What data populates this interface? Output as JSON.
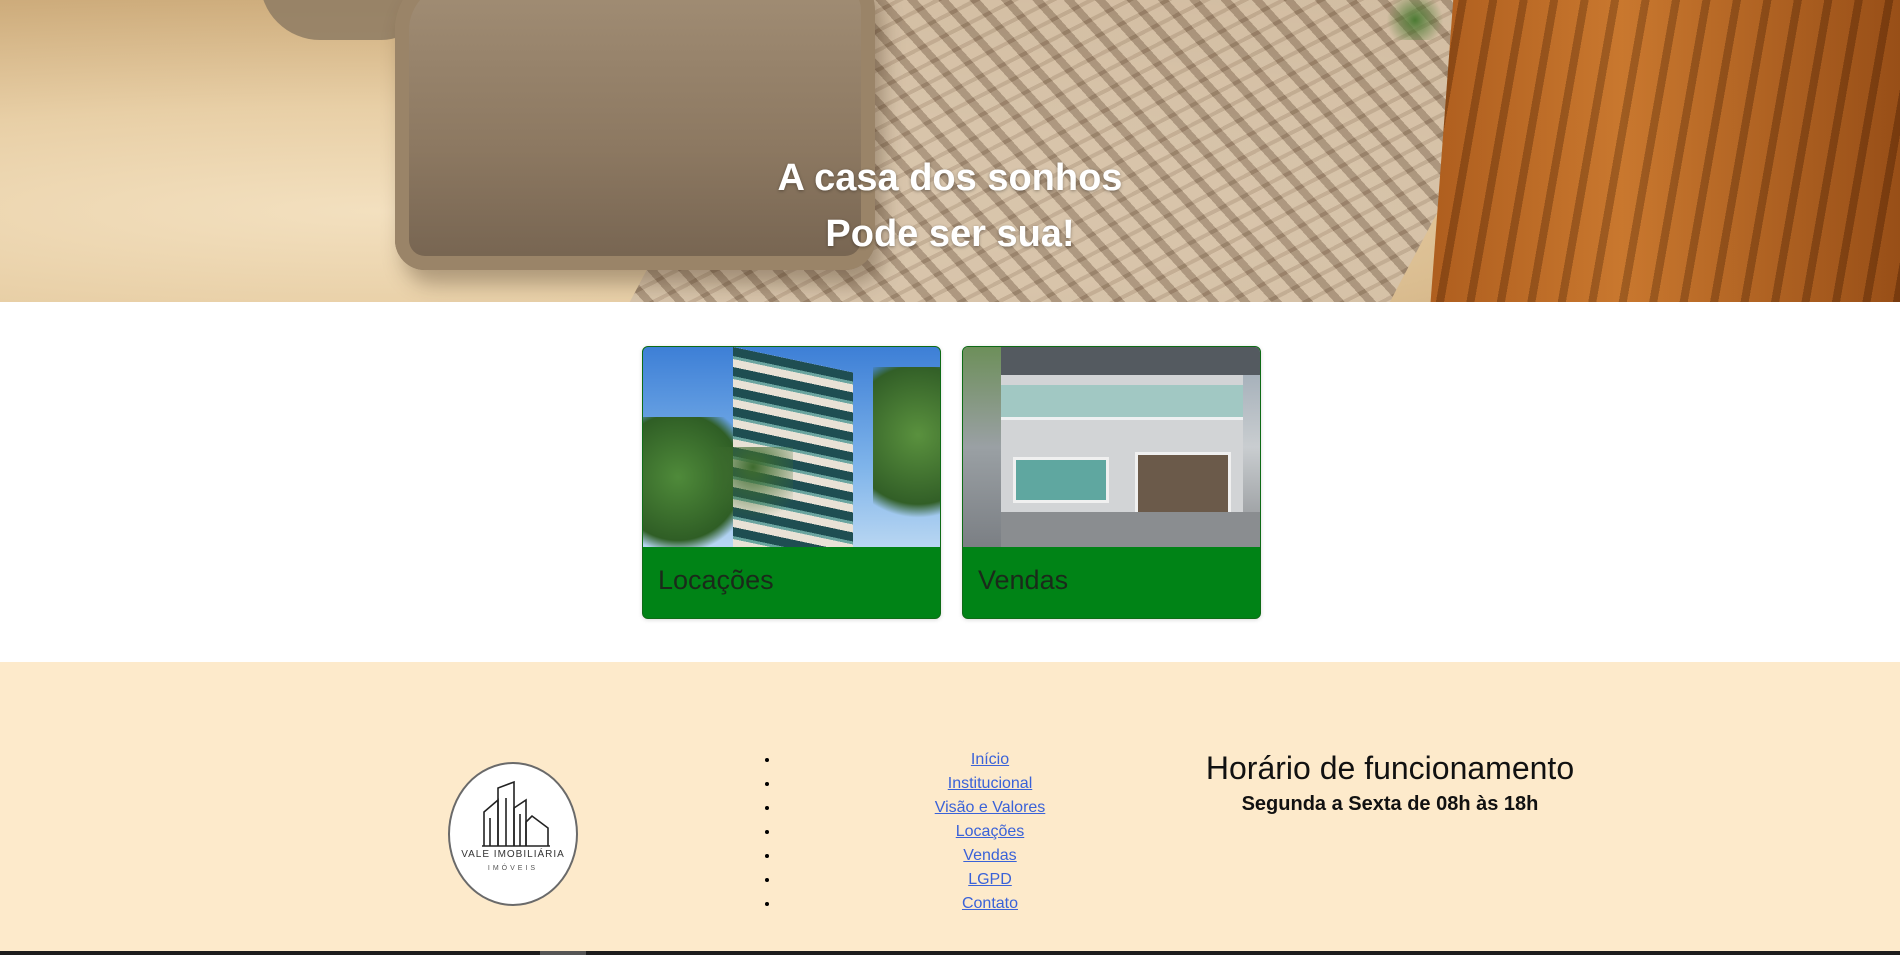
{
  "hero": {
    "line1": "A casa dos sonhos",
    "line2": "Pode ser sua!"
  },
  "cards": [
    {
      "title": "Locações",
      "image": "building-photo"
    },
    {
      "title": "Vendas",
      "image": "house-photo"
    }
  ],
  "footer": {
    "logo": {
      "name": "VALE IMOBILIÁRIA",
      "sub": "IMÓVEIS"
    },
    "nav": [
      "Início",
      "Institucional",
      "Visão e Valores",
      "Locações",
      "Vendas",
      "LGPD",
      "Contato"
    ],
    "hours_title": "Horário de funcionamento",
    "hours_text": "Segunda a Sexta de 08h às 18h"
  },
  "colors": {
    "card_green": "#008316",
    "footer_bg": "#fdeacb",
    "link": "#3a62d8"
  }
}
